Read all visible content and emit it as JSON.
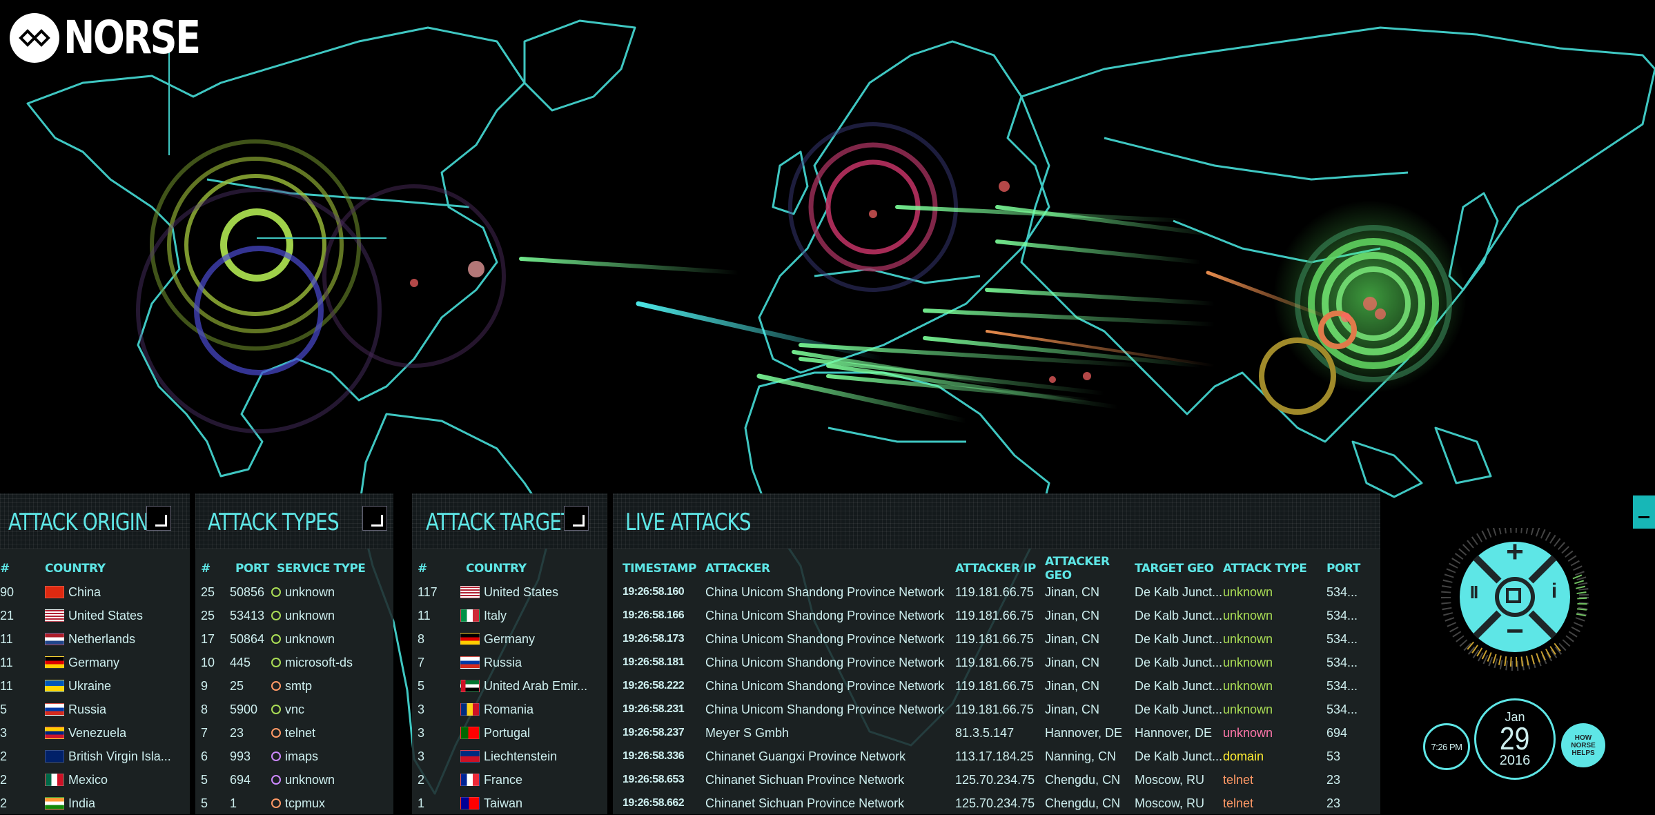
{
  "brand": {
    "name": "NORSE"
  },
  "colors": {
    "accent": "#5ee6e6",
    "unknown_svc": "#aadd55",
    "telnet": "#ff9966",
    "imaps": "#cc88ff",
    "domain": "#ffee33"
  },
  "panels": {
    "origins": {
      "title": "ATTACK ORIGINS",
      "headers": {
        "num": "#",
        "country": "COUNTRY"
      },
      "rows": [
        {
          "num": "90",
          "country": "China",
          "flag": "cn"
        },
        {
          "num": "21",
          "country": "United States",
          "flag": "us"
        },
        {
          "num": "11",
          "country": "Netherlands",
          "flag": "nl"
        },
        {
          "num": "11",
          "country": "Germany",
          "flag": "de"
        },
        {
          "num": "11",
          "country": "Ukraine",
          "flag": "ua"
        },
        {
          "num": "5",
          "country": "Russia",
          "flag": "ru"
        },
        {
          "num": "3",
          "country": "Venezuela",
          "flag": "ve"
        },
        {
          "num": "2",
          "country": "British Virgin Isla...",
          "flag": "vg"
        },
        {
          "num": "2",
          "country": "Mexico",
          "flag": "mx"
        },
        {
          "num": "2",
          "country": "India",
          "flag": "in"
        }
      ]
    },
    "types": {
      "title": "ATTACK TYPES",
      "headers": {
        "num": "#",
        "port": "PORT",
        "service": "SERVICE TYPE"
      },
      "rows": [
        {
          "num": "25",
          "port": "50856",
          "service": "unknown",
          "color": "#aadd55"
        },
        {
          "num": "25",
          "port": "53413",
          "service": "unknown",
          "color": "#aadd55"
        },
        {
          "num": "17",
          "port": "50864",
          "service": "unknown",
          "color": "#aadd55"
        },
        {
          "num": "10",
          "port": "445",
          "service": "microsoft-ds",
          "color": "#aadd55"
        },
        {
          "num": "9",
          "port": "25",
          "service": "smtp",
          "color": "#ff9966"
        },
        {
          "num": "8",
          "port": "5900",
          "service": "vnc",
          "color": "#aadd55"
        },
        {
          "num": "7",
          "port": "23",
          "service": "telnet",
          "color": "#ff9966"
        },
        {
          "num": "6",
          "port": "993",
          "service": "imaps",
          "color": "#cc88ff"
        },
        {
          "num": "5",
          "port": "694",
          "service": "unknown",
          "color": "#cc88ff"
        },
        {
          "num": "5",
          "port": "1",
          "service": "tcpmux",
          "color": "#ff9966"
        }
      ]
    },
    "targets": {
      "title": "ATTACK TARGETS",
      "headers": {
        "num": "#",
        "country": "COUNTRY"
      },
      "rows": [
        {
          "num": "117",
          "country": "United States",
          "flag": "us"
        },
        {
          "num": "11",
          "country": "Italy",
          "flag": "it"
        },
        {
          "num": "8",
          "country": "Germany",
          "flag": "de"
        },
        {
          "num": "7",
          "country": "Russia",
          "flag": "ru"
        },
        {
          "num": "5",
          "country": "United Arab Emir...",
          "flag": "ae"
        },
        {
          "num": "3",
          "country": "Romania",
          "flag": "ro"
        },
        {
          "num": "3",
          "country": "Portugal",
          "flag": "pt"
        },
        {
          "num": "3",
          "country": "Liechtenstein",
          "flag": "li"
        },
        {
          "num": "2",
          "country": "France",
          "flag": "fr"
        },
        {
          "num": "1",
          "country": "Taiwan",
          "flag": "tw"
        }
      ]
    },
    "live": {
      "title": "LIVE ATTACKS",
      "headers": {
        "timestamp": "TIMESTAMP",
        "attacker": "ATTACKER",
        "ip": "ATTACKER IP",
        "ageo": "ATTACKER GEO",
        "tgeo": "TARGET GEO",
        "type": "ATTACK TYPE",
        "port": "PORT"
      },
      "rows": [
        {
          "timestamp": "19:26:58.160",
          "attacker": "China Unicom Shandong Province Network",
          "ip": "119.181.66.75",
          "ageo": "Jinan, CN",
          "tgeo": "De Kalb Junct...",
          "type": "unknown",
          "type_color": "#aadd55",
          "port": "534..."
        },
        {
          "timestamp": "19:26:58.166",
          "attacker": "China Unicom Shandong Province Network",
          "ip": "119.181.66.75",
          "ageo": "Jinan, CN",
          "tgeo": "De Kalb Junct...",
          "type": "unknown",
          "type_color": "#aadd55",
          "port": "534..."
        },
        {
          "timestamp": "19:26:58.173",
          "attacker": "China Unicom Shandong Province Network",
          "ip": "119.181.66.75",
          "ageo": "Jinan, CN",
          "tgeo": "De Kalb Junct...",
          "type": "unknown",
          "type_color": "#aadd55",
          "port": "534..."
        },
        {
          "timestamp": "19:26:58.181",
          "attacker": "China Unicom Shandong Province Network",
          "ip": "119.181.66.75",
          "ageo": "Jinan, CN",
          "tgeo": "De Kalb Junct...",
          "type": "unknown",
          "type_color": "#aadd55",
          "port": "534..."
        },
        {
          "timestamp": "19:26:58.222",
          "attacker": "China Unicom Shandong Province Network",
          "ip": "119.181.66.75",
          "ageo": "Jinan, CN",
          "tgeo": "De Kalb Junct...",
          "type": "unknown",
          "type_color": "#aadd55",
          "port": "534..."
        },
        {
          "timestamp": "19:26:58.231",
          "attacker": "China Unicom Shandong Province Network",
          "ip": "119.181.66.75",
          "ageo": "Jinan, CN",
          "tgeo": "De Kalb Junct...",
          "type": "unknown",
          "type_color": "#aadd55",
          "port": "534..."
        },
        {
          "timestamp": "19:26:58.237",
          "attacker": "Meyer S Gmbh",
          "ip": "81.3.5.147",
          "ageo": "Hannover, DE",
          "tgeo": "Hannover, DE",
          "type": "unknown",
          "type_color": "#ff77aa",
          "port": "694"
        },
        {
          "timestamp": "19:26:58.336",
          "attacker": "Chinanet Guangxi Province Network",
          "ip": "113.17.184.25",
          "ageo": "Nanning, CN",
          "tgeo": "De Kalb Junct...",
          "type": "domain",
          "type_color": "#ffee33",
          "port": "53"
        },
        {
          "timestamp": "19:26:58.653",
          "attacker": "Chinanet Sichuan Province Network",
          "ip": "125.70.234.75",
          "ageo": "Chengdu, CN",
          "tgeo": "Moscow, RU",
          "type": "telnet",
          "type_color": "#ff9966",
          "port": "23"
        },
        {
          "timestamp": "19:26:58.662",
          "attacker": "Chinanet Sichuan Province Network",
          "ip": "125.70.234.75",
          "ageo": "Chengdu, CN",
          "tgeo": "Moscow, RU",
          "type": "telnet",
          "type_color": "#ff9966",
          "port": "23"
        }
      ]
    }
  },
  "controls": {
    "zoom_in": "+",
    "zoom_out": "−",
    "pause": "II",
    "info": "i",
    "time": "7:26 PM",
    "month": "Jan",
    "day": "29",
    "year": "2016",
    "help_line1": "HOW",
    "help_line2": "NORSE",
    "help_line3": "HELPS"
  },
  "icons": [
    "norse-logo-icon",
    "panel-toggle-icon",
    "zoom-in-icon",
    "zoom-out-icon",
    "pause-icon",
    "fullscreen-icon",
    "info-icon"
  ]
}
